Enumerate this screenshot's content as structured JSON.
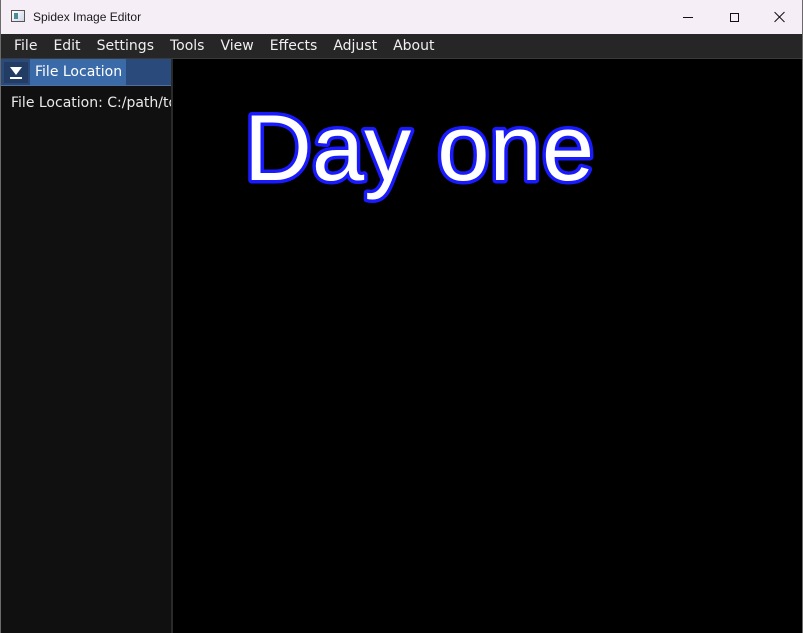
{
  "window": {
    "title": "Spidex Image Editor",
    "icon": "app-window-icon"
  },
  "menu": {
    "items": [
      "File",
      "Edit",
      "Settings",
      "Tools",
      "View",
      "Effects",
      "Adjust",
      "About"
    ]
  },
  "panel": {
    "tab_label": "File Location",
    "collapse_icon": "collapse-triangle-icon",
    "content_text": "File Location: C:/path/to"
  },
  "canvas": {
    "text": "Day one",
    "text_fill": "#ffffff",
    "text_outline": "#1a1aff",
    "background": "#000000"
  },
  "colors": {
    "titlebar_bg": "#f6eef6",
    "menubar_bg": "#262626",
    "panel_bg": "#101010",
    "panel_header_bg": "#294a7a",
    "panel_tab_bg": "#3a6aa8"
  }
}
